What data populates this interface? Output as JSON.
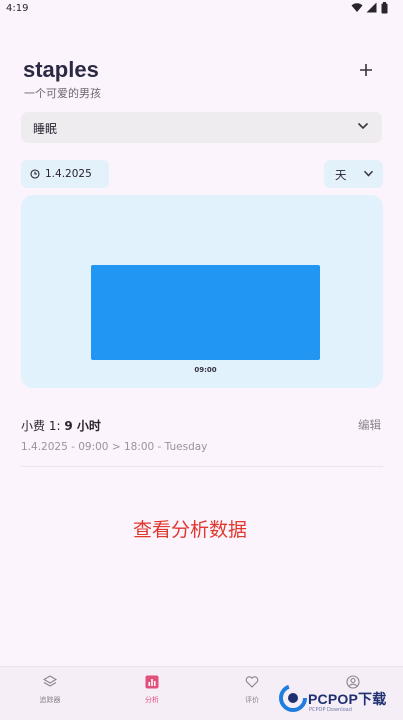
{
  "status": {
    "time": "4:19"
  },
  "header": {
    "title": "staples",
    "subtitle": "一个可爱的男孩"
  },
  "category": {
    "selected": "睡眠"
  },
  "date_filter": {
    "date": "1.4.2025"
  },
  "period": {
    "selected": "天"
  },
  "chart_data": {
    "type": "bar",
    "categories": [
      "09:00"
    ],
    "values": [
      9
    ],
    "series_color": "#2196f3"
  },
  "summary": {
    "label": "小费 1:",
    "value": "9 小时",
    "edit": "编辑",
    "detail": "1.4.2025 - 09:00 > 18:00  - Tuesday"
  },
  "cta": {
    "label": "查看分析数据"
  },
  "nav": {
    "items": [
      {
        "label": "追踪器",
        "icon": "layers-icon"
      },
      {
        "label": "分析",
        "icon": "bar-chart-icon"
      },
      {
        "label": "评价",
        "icon": "heart-icon"
      },
      {
        "label": "",
        "icon": "profile-icon"
      }
    ]
  },
  "watermark": {
    "brand": "PCPOP下载",
    "sub": "PCPOP Download"
  },
  "colors": {
    "accent": "#2196f3",
    "cta": "#e0382e",
    "active_nav": "#e2507c"
  }
}
